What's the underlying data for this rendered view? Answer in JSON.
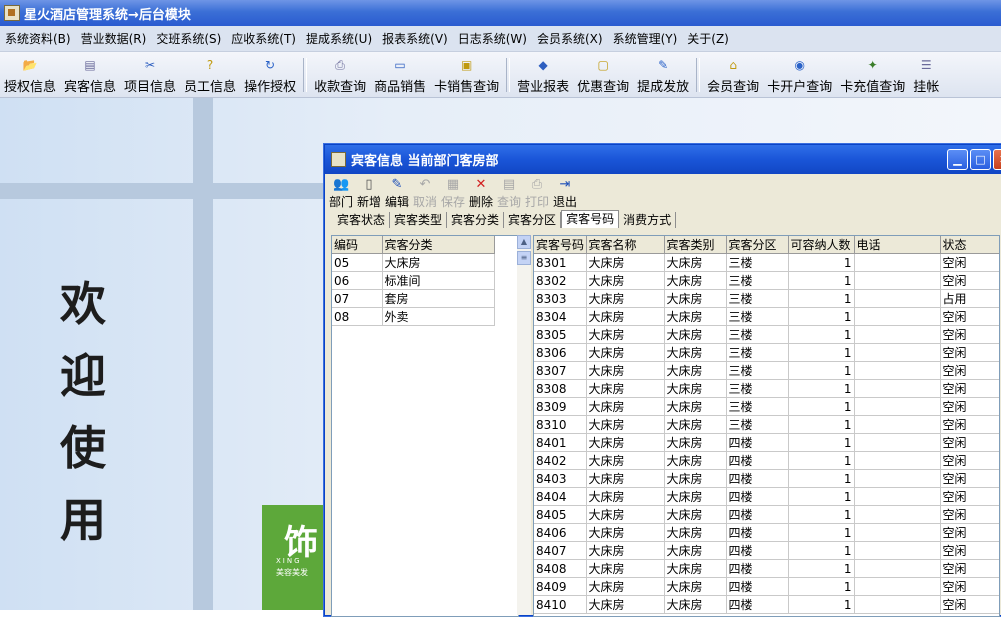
{
  "app": {
    "title": "星火酒店管理系统→后台模块"
  },
  "menu": [
    "系统资料(B)",
    "营业数据(R)",
    "交班系统(S)",
    "应收系统(T)",
    "提成系统(U)",
    "报表系统(V)",
    "日志系统(W)",
    "会员系统(X)",
    "系统管理(Y)",
    "关于(Z)"
  ],
  "toolbar": {
    "groups": [
      [
        {
          "label": "授权信息",
          "icon": "folder-key-icon"
        },
        {
          "label": "宾客信息",
          "icon": "document-icon"
        },
        {
          "label": "项目信息",
          "icon": "scissors-icon"
        },
        {
          "label": "员工信息",
          "icon": "question-icon"
        },
        {
          "label": "操作授权",
          "icon": "refresh-icon"
        }
      ],
      [
        {
          "label": "收款查询",
          "icon": "printer-icon"
        },
        {
          "label": "商品销售",
          "icon": "page-icon"
        },
        {
          "label": "卡销售查询",
          "icon": "card-icon"
        }
      ],
      [
        {
          "label": "营业报表",
          "icon": "diamond-icon"
        },
        {
          "label": "优惠查询",
          "icon": "monitor-icon"
        },
        {
          "label": "提成发放",
          "icon": "pencil-icon"
        }
      ],
      [
        {
          "label": "会员查询",
          "icon": "home-icon"
        },
        {
          "label": "卡开户查询",
          "icon": "eye-icon"
        },
        {
          "label": "卡充值查询",
          "icon": "gem-icon"
        },
        {
          "label": "挂帐",
          "icon": "list-icon"
        }
      ]
    ]
  },
  "desktop": {
    "welcome": [
      "欢",
      "迎",
      "使",
      "用"
    ],
    "logo_char": "饰",
    "logo_line1": "XING",
    "logo_line2": "美容美发"
  },
  "window": {
    "title": "宾客信息 当前部门客房部",
    "toolbar": [
      {
        "label": "部门",
        "enabled": true
      },
      {
        "label": "新增",
        "enabled": true
      },
      {
        "label": "编辑",
        "enabled": true
      },
      {
        "label": "取消",
        "enabled": false
      },
      {
        "label": "保存",
        "enabled": false
      },
      {
        "label": "删除",
        "enabled": true
      },
      {
        "label": "查询",
        "enabled": false
      },
      {
        "label": "打印",
        "enabled": false
      },
      {
        "label": "退出",
        "enabled": true
      }
    ],
    "tabs": [
      "宾客状态",
      "宾客类型",
      "宾客分类",
      "宾客分区",
      "宾客号码",
      "消费方式"
    ],
    "selected_tab": 4,
    "category_table": {
      "headers": [
        "编码",
        "宾客分类"
      ],
      "rows": [
        [
          "05",
          "大床房"
        ],
        [
          "06",
          "标准间"
        ],
        [
          "07",
          "套房"
        ],
        [
          "08",
          "外卖"
        ]
      ]
    },
    "guest_table": {
      "headers": [
        "宾客号码",
        "宾客名称",
        "宾客类别",
        "宾客分区",
        "可容纳人数",
        "电话",
        "状态"
      ],
      "rows": [
        [
          "8301",
          "大床房",
          "大床房",
          "三楼",
          "1",
          "",
          "空闲"
        ],
        [
          "8302",
          "大床房",
          "大床房",
          "三楼",
          "1",
          "",
          "空闲"
        ],
        [
          "8303",
          "大床房",
          "大床房",
          "三楼",
          "1",
          "",
          "占用"
        ],
        [
          "8304",
          "大床房",
          "大床房",
          "三楼",
          "1",
          "",
          "空闲"
        ],
        [
          "8305",
          "大床房",
          "大床房",
          "三楼",
          "1",
          "",
          "空闲"
        ],
        [
          "8306",
          "大床房",
          "大床房",
          "三楼",
          "1",
          "",
          "空闲"
        ],
        [
          "8307",
          "大床房",
          "大床房",
          "三楼",
          "1",
          "",
          "空闲"
        ],
        [
          "8308",
          "大床房",
          "大床房",
          "三楼",
          "1",
          "",
          "空闲"
        ],
        [
          "8309",
          "大床房",
          "大床房",
          "三楼",
          "1",
          "",
          "空闲"
        ],
        [
          "8310",
          "大床房",
          "大床房",
          "三楼",
          "1",
          "",
          "空闲"
        ],
        [
          "8401",
          "大床房",
          "大床房",
          "四楼",
          "1",
          "",
          "空闲"
        ],
        [
          "8402",
          "大床房",
          "大床房",
          "四楼",
          "1",
          "",
          "空闲"
        ],
        [
          "8403",
          "大床房",
          "大床房",
          "四楼",
          "1",
          "",
          "空闲"
        ],
        [
          "8404",
          "大床房",
          "大床房",
          "四楼",
          "1",
          "",
          "空闲"
        ],
        [
          "8405",
          "大床房",
          "大床房",
          "四楼",
          "1",
          "",
          "空闲"
        ],
        [
          "8406",
          "大床房",
          "大床房",
          "四楼",
          "1",
          "",
          "空闲"
        ],
        [
          "8407",
          "大床房",
          "大床房",
          "四楼",
          "1",
          "",
          "空闲"
        ],
        [
          "8408",
          "大床房",
          "大床房",
          "四楼",
          "1",
          "",
          "空闲"
        ],
        [
          "8409",
          "大床房",
          "大床房",
          "四楼",
          "1",
          "",
          "空闲"
        ],
        [
          "8410",
          "大床房",
          "大床房",
          "四楼",
          "1",
          "",
          "空闲"
        ]
      ]
    }
  }
}
